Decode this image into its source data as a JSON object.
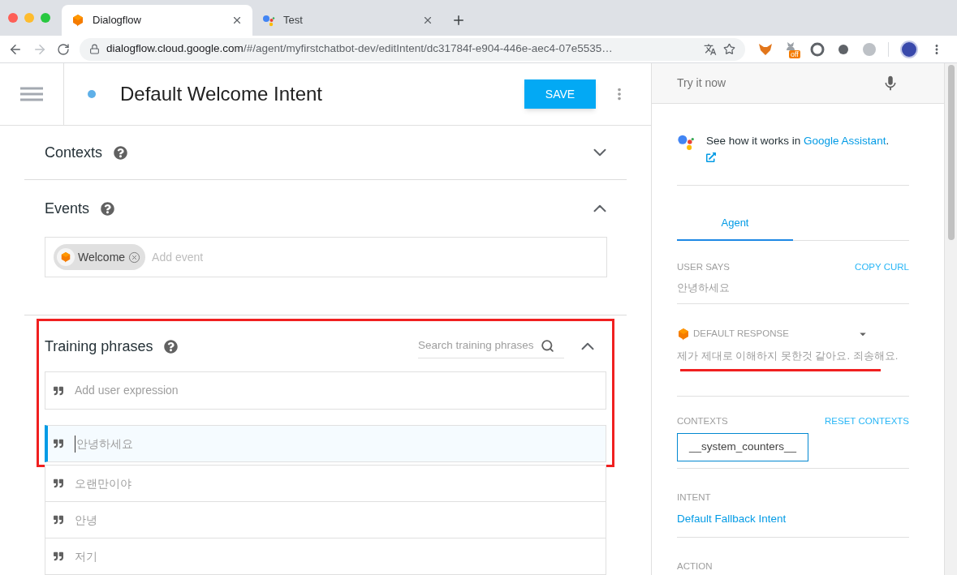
{
  "browser": {
    "tabs": [
      {
        "title": "Dialogflow",
        "kind": "dialogflow",
        "selected": true
      },
      {
        "title": "Test",
        "kind": "assistant",
        "selected": false
      }
    ],
    "address": {
      "host": "dialogflow.cloud.google.com",
      "path": "/#/agent/myfirstchatbot-dev/editIntent/dc31784f-e904-446e-aec4-07e5535…"
    },
    "extension_badge": "off"
  },
  "header": {
    "title": "Default Welcome Intent",
    "save": "SAVE"
  },
  "sections": [
    {
      "kind": "contexts",
      "title": "Contexts",
      "expanded": false
    },
    {
      "kind": "events",
      "title": "Events",
      "expanded": true,
      "chips": [
        {
          "label": "Welcome"
        }
      ],
      "placeholder": "Add event"
    },
    {
      "kind": "training",
      "title": "Training phrases",
      "expanded": true,
      "search_placeholder": "Search training phrases",
      "input_placeholder": "Add user expression",
      "phrases": [
        {
          "text": "안녕하세요",
          "selected": true
        },
        {
          "text": "오랜만이야",
          "selected": false
        },
        {
          "text": "안녕",
          "selected": false
        },
        {
          "text": "저기",
          "selected": false
        }
      ]
    }
  ],
  "console": {
    "placeholder": "Try it now",
    "promo": {
      "text": "See how it works in",
      "link": "Google Assistant",
      "after": "."
    },
    "tabs": [
      {
        "label": "Agent",
        "selected": true
      }
    ],
    "user_says": {
      "label": "USER SAYS",
      "action": "COPY CURL",
      "value": "안녕하세요"
    },
    "response": {
      "label": "DEFAULT RESPONSE",
      "text": "제가 제대로 이해하지 못한것 같아요. 죄송해요."
    },
    "contexts": {
      "label": "CONTEXTS",
      "action": "RESET CONTEXTS",
      "chips": [
        "__system_counters__"
      ]
    },
    "intent": {
      "label": "INTENT",
      "value": "Default Fallback Intent"
    },
    "action": {
      "label": "ACTION"
    }
  }
}
